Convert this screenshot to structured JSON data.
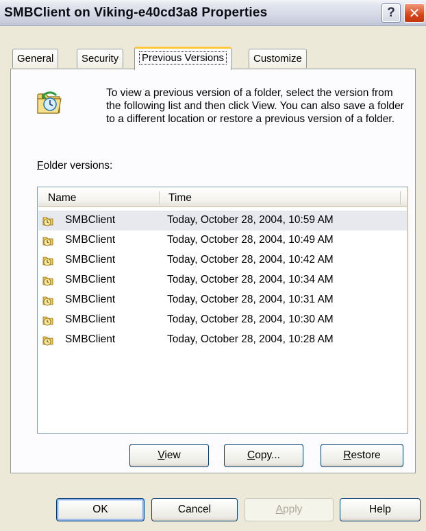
{
  "window": {
    "title": "SMBClient on Viking-e40cd3a8 Properties",
    "help_glyph": "?",
    "close_glyph": "✕"
  },
  "tabs": [
    {
      "label": "General"
    },
    {
      "label": "Security"
    },
    {
      "label": "Previous Versions",
      "active": true
    },
    {
      "label": "Customize"
    }
  ],
  "description": "To view a previous version of a folder, select the version from the following list and then click View.  You can also save a folder to a different location or restore a previous version of a folder.",
  "versions_label": {
    "mnemonic": "F",
    "rest": "older versions:"
  },
  "list": {
    "columns": [
      "Name",
      "Time"
    ],
    "rows": [
      {
        "name": "SMBClient",
        "time": "Today, October 28, 2004, 10:59 AM",
        "selected": true
      },
      {
        "name": "SMBClient",
        "time": "Today, October 28, 2004, 10:49 AM"
      },
      {
        "name": "SMBClient",
        "time": "Today, October 28, 2004, 10:42 AM"
      },
      {
        "name": "SMBClient",
        "time": "Today, October 28, 2004, 10:34 AM"
      },
      {
        "name": "SMBClient",
        "time": "Today, October 28, 2004, 10:31 AM"
      },
      {
        "name": "SMBClient",
        "time": "Today, October 28, 2004, 10:30 AM"
      },
      {
        "name": "SMBClient",
        "time": "Today, October 28, 2004, 10:28 AM"
      }
    ]
  },
  "actions": {
    "view": {
      "mnemonic": "V",
      "rest": "iew"
    },
    "copy": {
      "mnemonic": "C",
      "rest": "opy..."
    },
    "restore": {
      "mnemonic": "R",
      "rest": "estore"
    }
  },
  "footer": {
    "ok": "OK",
    "cancel": "Cancel",
    "apply": {
      "mnemonic": "A",
      "rest": "pply",
      "disabled": true
    },
    "help": "Help"
  },
  "colors": {
    "selection": "#e8e8ef",
    "tab_highlight": "#ffc83c",
    "close_button": "#d8431a"
  },
  "icons": {
    "header": "folder-restore-clock-icon",
    "row": "folder-clock-icon"
  }
}
